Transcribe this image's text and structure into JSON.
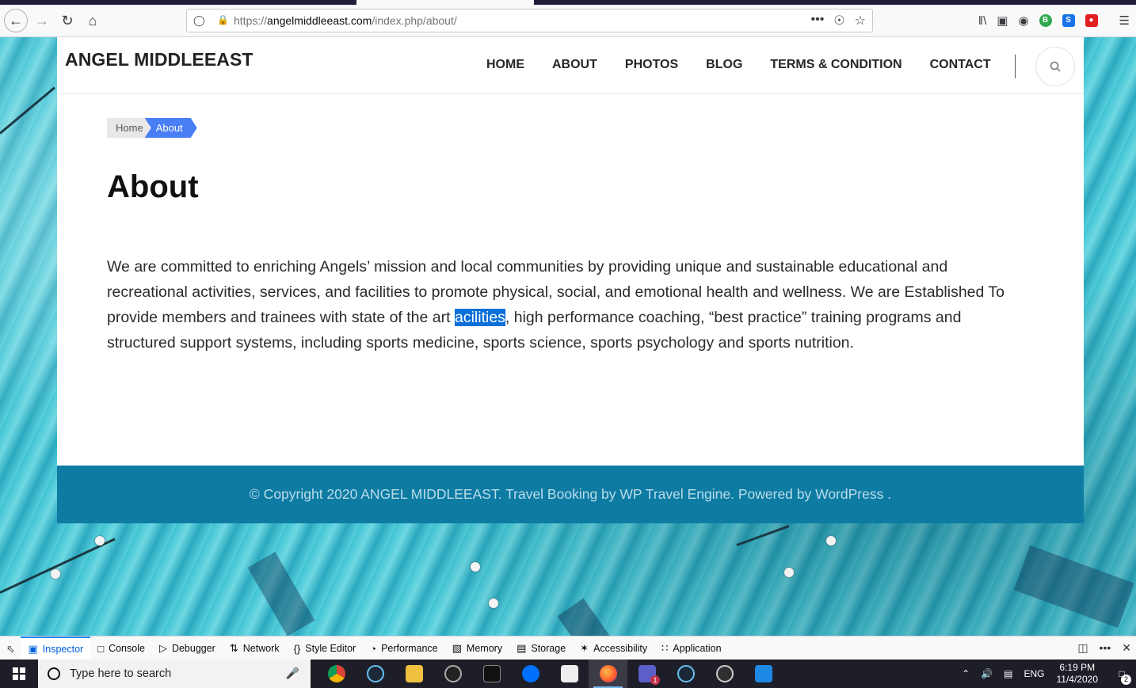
{
  "browser": {
    "url_prefix": "https://",
    "url_domain": "angelmiddleeast.com",
    "url_path": "/index.php/about/",
    "url_more": "•••"
  },
  "site": {
    "logo": "ANGEL MIDDLEEAST",
    "menu": [
      "HOME",
      "ABOUT",
      "PHOTOS",
      "BLOG",
      "TERMS & CONDITION",
      "CONTACT"
    ],
    "breadcrumb": {
      "home": "Home",
      "current": "About"
    },
    "page_title": "About",
    "body_before": "We are committed to enriching Angels’ mission and local communities by providing unique and sustainable educational and recreational activities, services, and facilities to promote physical, social, and emotional health and wellness. We are Established To provide members and trainees with state of the art ",
    "body_selected": "acilities",
    "body_after": ", high performance coaching, “best practice” training programs and structured support systems, including sports medicine, sports science, sports psychology and sports nutrition.",
    "footer": "© Copyright 2020 ANGEL MIDDLEEAST. Travel Booking by WP Travel Engine. Powered by WordPress ."
  },
  "devtools": {
    "tabs": [
      "Inspector",
      "Console",
      "Debugger",
      "Network",
      "Style Editor",
      "Performance",
      "Memory",
      "Storage",
      "Accessibility",
      "Application"
    ],
    "active": "Inspector"
  },
  "taskbar": {
    "search_placeholder": "Type here to search",
    "lang": "ENG",
    "time": "6:19 PM",
    "date": "11/4/2020",
    "notifications": "2",
    "teams_badge": "1"
  },
  "colors": {
    "accent": "#4a7ef5",
    "footer": "#0e7ba3",
    "selection": "#0a6fd8"
  }
}
